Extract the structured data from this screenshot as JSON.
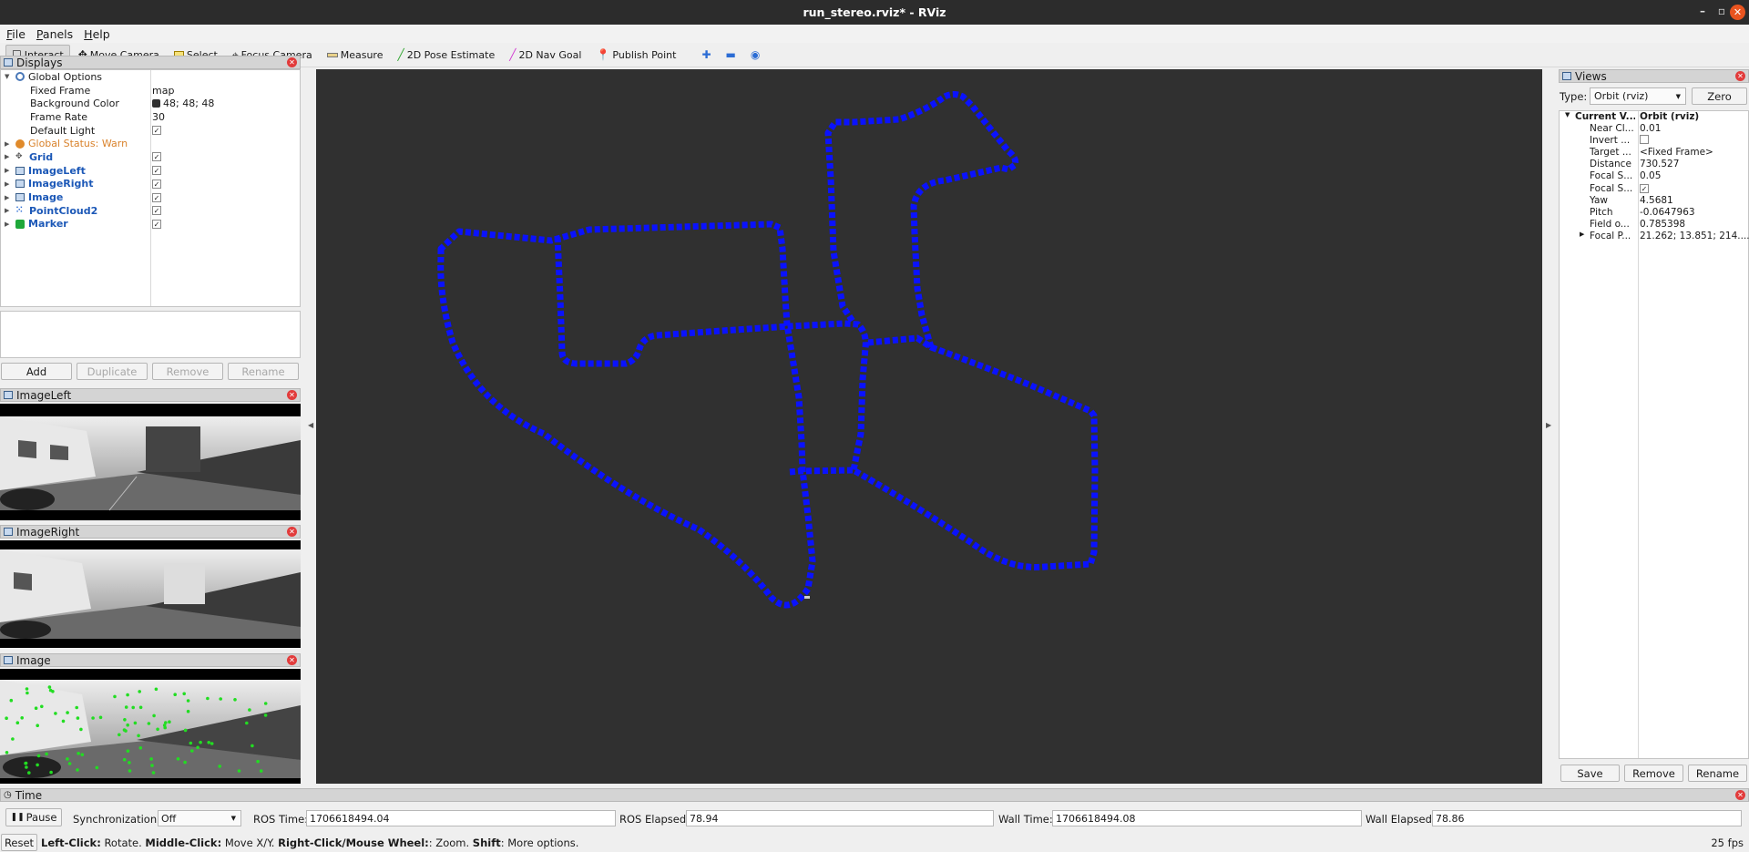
{
  "window": {
    "title": "run_stereo.rviz* - RViz",
    "controls": [
      "–",
      "▫",
      "✕"
    ]
  },
  "menu": [
    "File",
    "Panels",
    "Help"
  ],
  "toolbar": {
    "tools": [
      {
        "label": "Interact",
        "icon": "interact-icon",
        "active": true
      },
      {
        "label": "Move Camera",
        "icon": "move-camera-icon"
      },
      {
        "label": "Select",
        "icon": "select-icon"
      },
      {
        "label": "Focus Camera",
        "icon": "focus-camera-icon"
      },
      {
        "label": "Measure",
        "icon": "measure-icon"
      },
      {
        "label": "2D Pose Estimate",
        "icon": "pose-estimate-icon",
        "color": "#2fa52f"
      },
      {
        "label": "2D Nav Goal",
        "icon": "nav-goal-icon",
        "color": "#d23ad2"
      },
      {
        "label": "Publish Point",
        "icon": "publish-point-icon",
        "color": "#d9362b"
      }
    ],
    "extra_icons": [
      "add-tool-icon",
      "remove-tool-icon",
      "camera-type-icon"
    ]
  },
  "displays": {
    "title": "Displays",
    "global_options": {
      "label": "Global Options",
      "fixed_frame": {
        "label": "Fixed Frame",
        "value": "map"
      },
      "background_color": {
        "label": "Background Color",
        "value": "48; 48; 48",
        "swatch": "#303030"
      },
      "frame_rate": {
        "label": "Frame Rate",
        "value": "30"
      },
      "default_light": {
        "label": "Default Light",
        "checked": true
      }
    },
    "global_status": "Global Status: Warn",
    "items": [
      {
        "label": "Grid",
        "icon": "grid-icon",
        "checked": true
      },
      {
        "label": "ImageLeft",
        "icon": "image-icon",
        "checked": true
      },
      {
        "label": "ImageRight",
        "icon": "image-icon",
        "checked": true
      },
      {
        "label": "Image",
        "icon": "image-icon",
        "checked": true
      },
      {
        "label": "PointCloud2",
        "icon": "pointcloud-icon",
        "checked": true
      },
      {
        "label": "Marker",
        "icon": "marker-icon",
        "checked": true
      }
    ],
    "buttons": {
      "add": "Add",
      "duplicate": "Duplicate",
      "remove": "Remove",
      "rename": "Rename"
    }
  },
  "image_panels": [
    {
      "title": "ImageLeft"
    },
    {
      "title": "ImageRight"
    },
    {
      "title": "Image"
    }
  ],
  "viewport": {
    "background": "#303030",
    "trajectory_color": "#0a12ff"
  },
  "views": {
    "title": "Views",
    "type_label": "Type:",
    "type_value": "Orbit (rviz)",
    "zero_button": "Zero",
    "current_view": {
      "label": "Current V...",
      "value": "Orbit (rviz)"
    },
    "props": [
      {
        "name": "Near Cl...",
        "value": "0.01"
      },
      {
        "name": "Invert ...",
        "value": "",
        "checkbox": true,
        "checked": false
      },
      {
        "name": "Target ...",
        "value": "<Fixed Frame>"
      },
      {
        "name": "Distance",
        "value": "730.527"
      },
      {
        "name": "Focal S...",
        "value": "0.05"
      },
      {
        "name": "Focal S...",
        "value": "",
        "checkbox": true,
        "checked": true
      },
      {
        "name": "Yaw",
        "value": "4.5681"
      },
      {
        "name": "Pitch",
        "value": "-0.0647963"
      },
      {
        "name": "Field o...",
        "value": "0.785398"
      },
      {
        "name": "Focal P...",
        "value": "21.262; 13.851; 214...."
      }
    ],
    "buttons": {
      "save": "Save",
      "remove": "Remove",
      "rename": "Rename"
    }
  },
  "time": {
    "title": "Time",
    "pause": "Pause",
    "sync_label": "Synchronization:",
    "sync_value": "Off",
    "ros_time_label": "ROS Time:",
    "ros_time": "1706618494.04",
    "ros_elapsed_label": "ROS Elapsed:",
    "ros_elapsed": "78.94",
    "wall_time_label": "Wall Time:",
    "wall_time": "1706618494.08",
    "wall_elapsed_label": "Wall Elapsed:",
    "wall_elapsed": "78.86"
  },
  "status": {
    "reset": "Reset",
    "hint_parts": [
      {
        "bold": true,
        "text": "Left-Click:"
      },
      {
        "bold": false,
        "text": " Rotate. "
      },
      {
        "bold": true,
        "text": "Middle-Click:"
      },
      {
        "bold": false,
        "text": " Move X/Y. "
      },
      {
        "bold": true,
        "text": "Right-Click/Mouse Wheel:"
      },
      {
        "bold": false,
        "text": ": Zoom. "
      },
      {
        "bold": true,
        "text": "Shift"
      },
      {
        "bold": false,
        "text": ": More options."
      }
    ],
    "fps": "25 fps"
  }
}
